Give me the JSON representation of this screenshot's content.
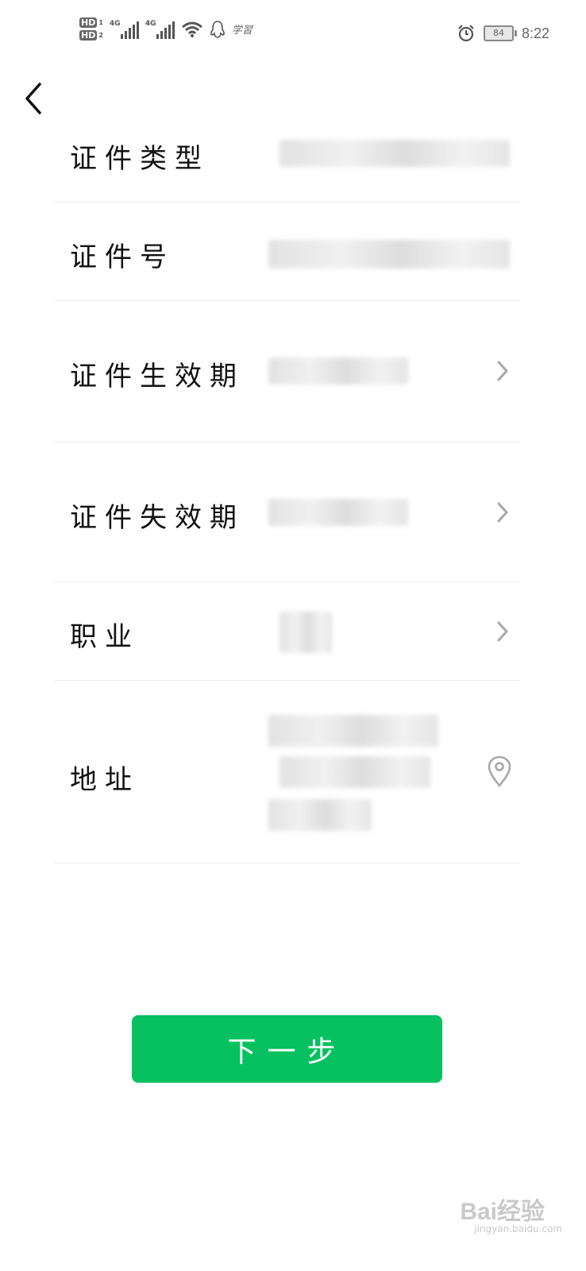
{
  "status_bar": {
    "hd1": "HD",
    "hd1_num": "1",
    "hd2": "HD",
    "hd2_num": "2",
    "net1": "4G",
    "net2": "4G",
    "app_text": "学習",
    "battery": "84",
    "time": "8:22",
    "icons": [
      "wifi-icon",
      "qq-icon",
      "alarm-icon"
    ]
  },
  "nav": {
    "back_icon": "chevron-left-icon"
  },
  "form": {
    "rows": [
      {
        "label": "证件类型"
      },
      {
        "label": "证件号"
      },
      {
        "label": "证件生效期"
      },
      {
        "label": "证件失效期"
      },
      {
        "label": "职业"
      },
      {
        "label": "地址"
      }
    ]
  },
  "actions": {
    "next_label": "下一步"
  },
  "watermark": {
    "text": "Bai经验",
    "sub": "jingyan.baidu.com"
  },
  "colors": {
    "accent": "#07c160",
    "divider": "#ececec",
    "chevron": "#a8a8a8"
  }
}
